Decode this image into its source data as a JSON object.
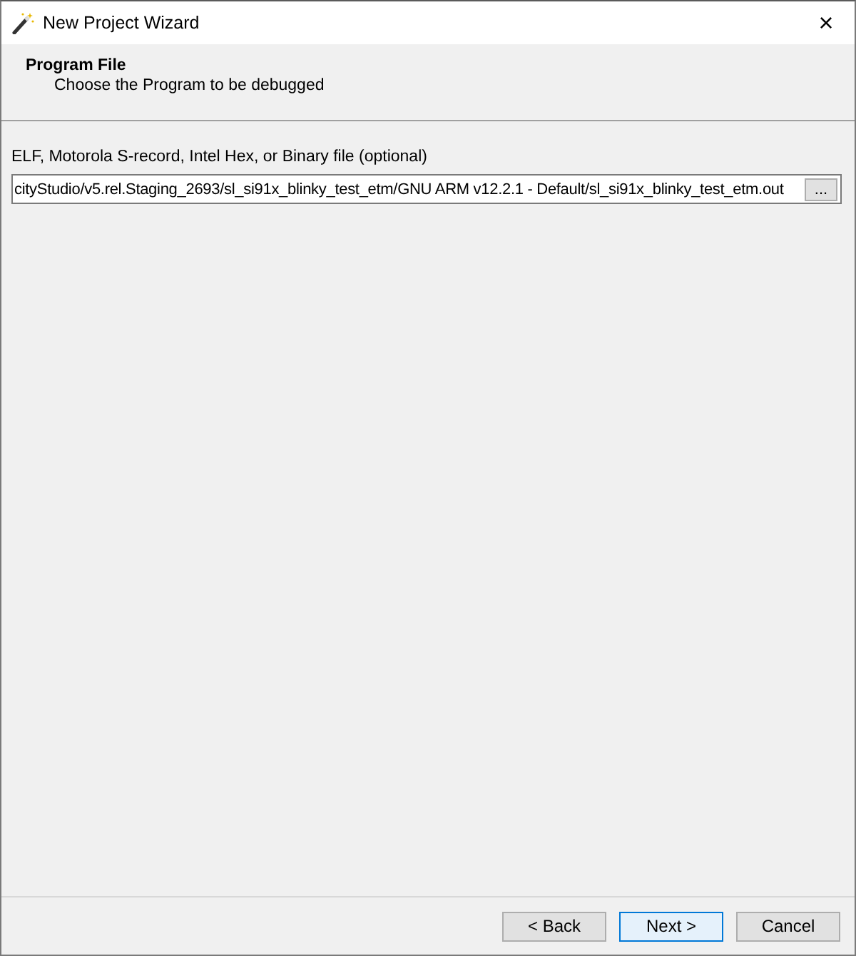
{
  "window": {
    "title": "New Project Wizard",
    "close": "×"
  },
  "header": {
    "title": "Program File",
    "description": "Choose the Program to be debugged"
  },
  "program_file": {
    "label": "ELF, Motorola S-record, Intel Hex, or Binary file (optional)",
    "value": "cityStudio/v5.rel.Staging_2693/sl_si91x_blinky_test_etm/GNU ARM v12.2.1 - Default/sl_si91x_blinky_test_etm.out",
    "browse": "..."
  },
  "buttons": [
    {
      "label": "< Back",
      "default": false
    },
    {
      "label": "Next >",
      "default": true
    },
    {
      "label": "Cancel",
      "default": false
    }
  ]
}
